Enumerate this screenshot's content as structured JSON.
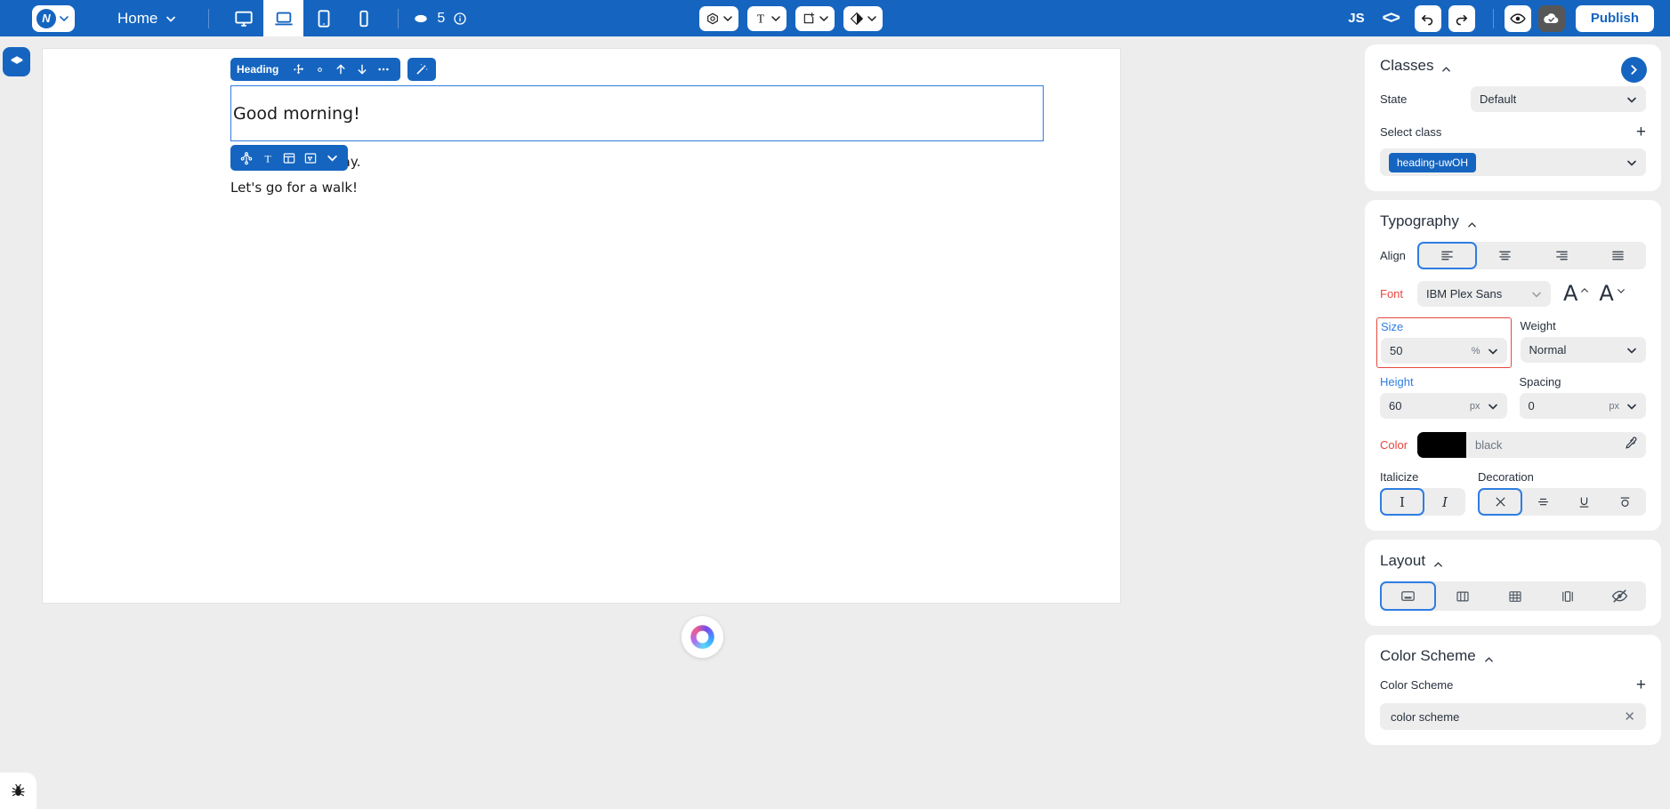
{
  "topbar": {
    "brand_letter": "N",
    "home_label": "Home",
    "devices": [
      {
        "name": "desktop",
        "active": false
      },
      {
        "name": "laptop",
        "active": true
      },
      {
        "name": "tablet",
        "active": false
      },
      {
        "name": "mobile",
        "active": false
      }
    ],
    "layers_count": "5",
    "tool_buttons": [
      "palette",
      "text",
      "add-block",
      "theme"
    ],
    "js_label": "JS",
    "publish_label": "Publish",
    "accent": "#1565c0"
  },
  "canvas": {
    "heading_toolbar_label": "Heading",
    "heading_text": "Good morning!",
    "paragraph_1": "It is pleasant today.",
    "paragraph_2": "Let's go for a walk!"
  },
  "classes": {
    "title": "Classes",
    "state_label": "State",
    "state_value": "Default",
    "select_class_label": "Select class",
    "class_chip": "heading-uwOH"
  },
  "typography": {
    "title": "Typography",
    "align_label": "Align",
    "align_options": [
      "left",
      "center",
      "right",
      "justify"
    ],
    "align_selected": 0,
    "font_label": "Font",
    "font_value": "IBM Plex Sans",
    "size_label": "Size",
    "size_value": "50",
    "size_unit": "%",
    "weight_label": "Weight",
    "weight_value": "Normal",
    "height_label": "Height",
    "height_value": "60",
    "height_unit": "px",
    "spacing_label": "Spacing",
    "spacing_value": "0",
    "spacing_unit": "px",
    "color_label": "Color",
    "color_value": "black",
    "color_swatch": "#000000",
    "italicize_label": "Italicize",
    "italicize_selected": 0,
    "decoration_label": "Decoration",
    "decoration_selected": 0
  },
  "layout": {
    "title": "Layout",
    "options": [
      "block",
      "flex",
      "grid",
      "columns",
      "hidden"
    ],
    "selected": 0
  },
  "color_scheme": {
    "title": "Color Scheme",
    "field_label": "Color Scheme",
    "chip_label": "color scheme"
  }
}
